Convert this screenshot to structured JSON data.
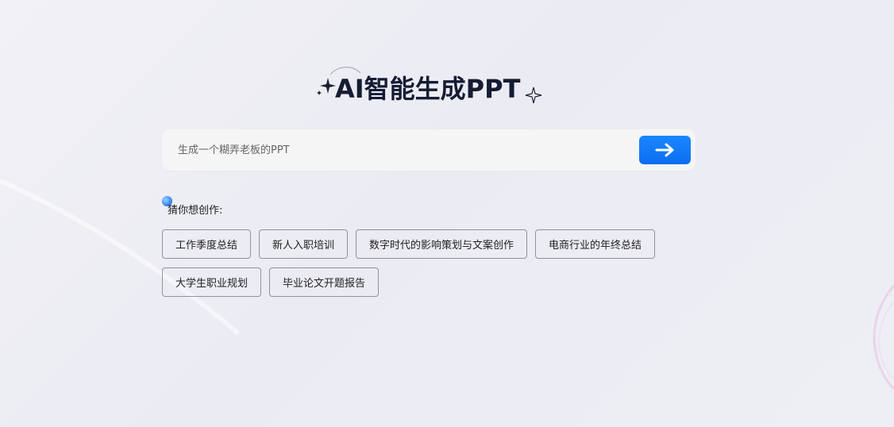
{
  "title": "AI智能生成PPT",
  "search": {
    "placeholder": "生成一个糊弄老板的PPT",
    "value": ""
  },
  "suggestions": {
    "label": "猜你想创作:",
    "items": [
      "工作季度总结",
      "新人入职培训",
      "数字时代的影响策划与文案创作",
      "电商行业的年终总结",
      "大学生职业规划",
      "毕业论文开题报告"
    ]
  },
  "colors": {
    "accent": "#0b6ef0",
    "title": "#151c33",
    "background": "#ececf3"
  },
  "icons": {
    "send": "arrow-right-icon",
    "sparkle": "sparkle-icon",
    "suggest": "gradient-dot-icon"
  }
}
